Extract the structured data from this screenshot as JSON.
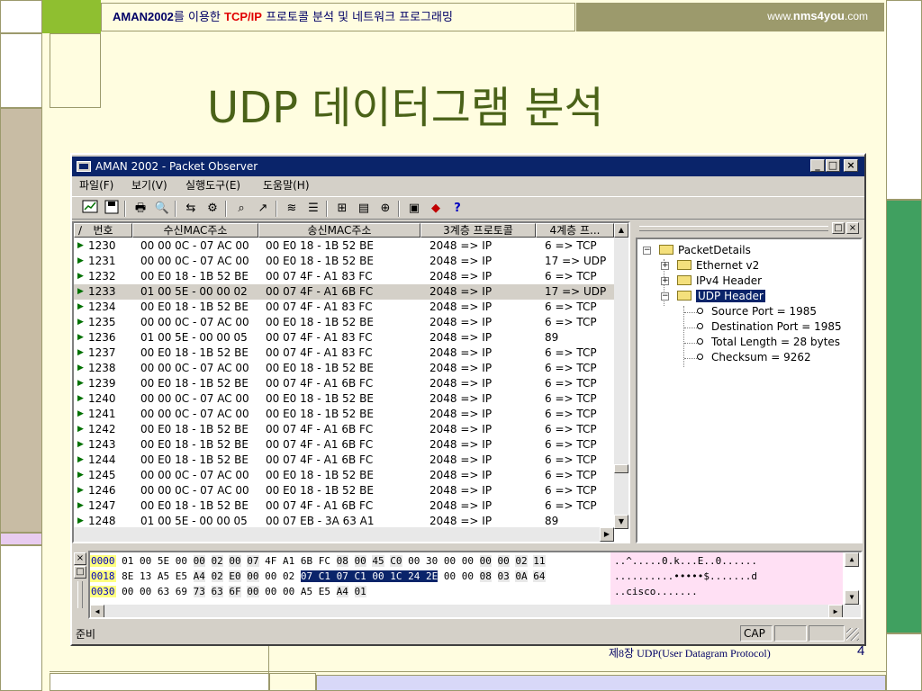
{
  "slide": {
    "banner_app": "AMAN2002",
    "banner_mid": "를 이용한 ",
    "banner_tcpip": "TCP/IP",
    "banner_rest": " 프로토콜 분석 및 네트워크 프로그래밍",
    "url_prefix": "www.",
    "url_bold": "nms4you",
    "url_suffix": ".com",
    "title": "UDP 데이터그램 분석",
    "footer": "제8장  UDP(User Datagram Protocol)",
    "page": "4"
  },
  "colors": {
    "title": "#4a6218",
    "banner_text": "#000066",
    "banner_red": "#e00000",
    "url_bg": "#9c9a6c",
    "slide_bg": "#fffde0",
    "win_title": "#0a246a",
    "win_face": "#d4d0c8"
  },
  "window": {
    "title": "AMAN 2002 - Packet Observer",
    "caption_buttons": [
      "_",
      "□",
      "×"
    ],
    "menu": [
      "파일(F)",
      "보기(V)",
      "실행도구(E)",
      "도움말(H)"
    ],
    "toolbar_icons": [
      "chart-icon",
      "save-icon",
      "print-icon",
      "print-preview-icon",
      "capture-start-icon",
      "capture-filter-icon",
      "search-icon",
      "export-icon",
      "statistics-icon",
      "list-icon",
      "network-icon",
      "traffic-icon",
      "zoom-icon",
      "open-file-icon",
      "stop-icon",
      "help-icon"
    ]
  },
  "packet_list": {
    "columns": [
      "번호",
      "수신MAC주소",
      "송신MAC주소",
      "3계층 프로토콜",
      "4계층 프..."
    ],
    "rows": [
      {
        "no": "1230",
        "dst": "00 00 0C - 07 AC 00",
        "src": "00 E0 18 - 1B 52 BE",
        "l3": "2048 => IP",
        "l4": "6  => TCP"
      },
      {
        "no": "1231",
        "dst": "00 00 0C - 07 AC 00",
        "src": "00 E0 18 - 1B 52 BE",
        "l3": "2048 => IP",
        "l4": "17 => UDP"
      },
      {
        "no": "1232",
        "dst": "00 E0 18 - 1B 52 BE",
        "src": "00 07 4F - A1 83 FC",
        "l3": "2048 => IP",
        "l4": "6  => TCP"
      },
      {
        "no": "1233",
        "dst": "01 00 5E - 00 00 02",
        "src": "00 07 4F - A1 6B FC",
        "l3": "2048 => IP",
        "l4": "17 => UDP",
        "selected": true
      },
      {
        "no": "1234",
        "dst": "00 E0 18 - 1B 52 BE",
        "src": "00 07 4F - A1 83 FC",
        "l3": "2048 => IP",
        "l4": "6  => TCP"
      },
      {
        "no": "1235",
        "dst": "00 00 0C - 07 AC 00",
        "src": "00 E0 18 - 1B 52 BE",
        "l3": "2048 => IP",
        "l4": "6  => TCP"
      },
      {
        "no": "1236",
        "dst": "01 00 5E - 00 00 05",
        "src": "00 07 4F - A1 83 FC",
        "l3": "2048 => IP",
        "l4": "89"
      },
      {
        "no": "1237",
        "dst": "00 E0 18 - 1B 52 BE",
        "src": "00 07 4F - A1 83 FC",
        "l3": "2048 => IP",
        "l4": "6  => TCP"
      },
      {
        "no": "1238",
        "dst": "00 00 0C - 07 AC 00",
        "src": "00 E0 18 - 1B 52 BE",
        "l3": "2048 => IP",
        "l4": "6  => TCP"
      },
      {
        "no": "1239",
        "dst": "00 E0 18 - 1B 52 BE",
        "src": "00 07 4F - A1 6B FC",
        "l3": "2048 => IP",
        "l4": "6  => TCP"
      },
      {
        "no": "1240",
        "dst": "00 00 0C - 07 AC 00",
        "src": "00 E0 18 - 1B 52 BE",
        "l3": "2048 => IP",
        "l4": "6  => TCP"
      },
      {
        "no": "1241",
        "dst": "00 00 0C - 07 AC 00",
        "src": "00 E0 18 - 1B 52 BE",
        "l3": "2048 => IP",
        "l4": "6  => TCP"
      },
      {
        "no": "1242",
        "dst": "00 E0 18 - 1B 52 BE",
        "src": "00 07 4F - A1 6B FC",
        "l3": "2048 => IP",
        "l4": "6  => TCP"
      },
      {
        "no": "1243",
        "dst": "00 E0 18 - 1B 52 BE",
        "src": "00 07 4F - A1 6B FC",
        "l3": "2048 => IP",
        "l4": "6  => TCP"
      },
      {
        "no": "1244",
        "dst": "00 E0 18 - 1B 52 BE",
        "src": "00 07 4F - A1 6B FC",
        "l3": "2048 => IP",
        "l4": "6  => TCP"
      },
      {
        "no": "1245",
        "dst": "00 00 0C - 07 AC 00",
        "src": "00 E0 18 - 1B 52 BE",
        "l3": "2048 => IP",
        "l4": "6  => TCP"
      },
      {
        "no": "1246",
        "dst": "00 00 0C - 07 AC 00",
        "src": "00 E0 18 - 1B 52 BE",
        "l3": "2048 => IP",
        "l4": "6  => TCP"
      },
      {
        "no": "1247",
        "dst": "00 E0 18 - 1B 52 BE",
        "src": "00 07 4F - A1 6B FC",
        "l3": "2048 => IP",
        "l4": "6  => TCP"
      },
      {
        "no": "1248",
        "dst": "01 00 5E - 00 00 05",
        "src": "00 07 EB - 3A 63 A1",
        "l3": "2048 => IP",
        "l4": "89"
      }
    ]
  },
  "tree": {
    "root": "PacketDetails",
    "nodes": [
      {
        "label": "Ethernet v2",
        "expander": "+"
      },
      {
        "label": "IPv4 Header",
        "expander": "+"
      },
      {
        "label": "UDP Header",
        "expander": "−",
        "selected": true
      }
    ],
    "leaves": [
      "Source Port = 1985",
      "Destination Port = 1985",
      "Total Length = 28 bytes",
      "Checksum = 9262"
    ],
    "header_buttons": [
      "□",
      "×"
    ]
  },
  "hex": {
    "lines": [
      {
        "offset": "0000",
        "bytes": [
          "01",
          "00",
          "5E",
          "00",
          "00",
          "02",
          "00",
          "07",
          "4F",
          "A1",
          "6B",
          "FC",
          "08",
          "00",
          "45",
          "C0",
          "00",
          "30",
          "00",
          "00",
          "00",
          "00",
          "02",
          "11"
        ],
        "ascii": "..^.....0.k...E..0......"
      },
      {
        "offset": "0018",
        "bytes": [
          "8E",
          "13",
          "A5",
          "E5",
          "A4",
          "02",
          "E0",
          "00",
          "00",
          "02",
          "07",
          "C1",
          "07",
          "C1",
          "00",
          "1C",
          "24",
          "2E",
          "00",
          "00",
          "08",
          "03",
          "0A",
          "64"
        ],
        "ascii": "..........•••••$.......d"
      },
      {
        "offset": "0030",
        "bytes": [
          "00",
          "00",
          "63",
          "69",
          "73",
          "63",
          "6F",
          "00",
          "00",
          "00",
          "A5",
          "E5",
          "A4",
          "01"
        ],
        "ascii": "..cisco......."
      }
    ],
    "highlight_line": 1,
    "highlight_from": 10,
    "highlight_to": 17
  },
  "status": {
    "text": "준비",
    "cap": "CAP"
  }
}
